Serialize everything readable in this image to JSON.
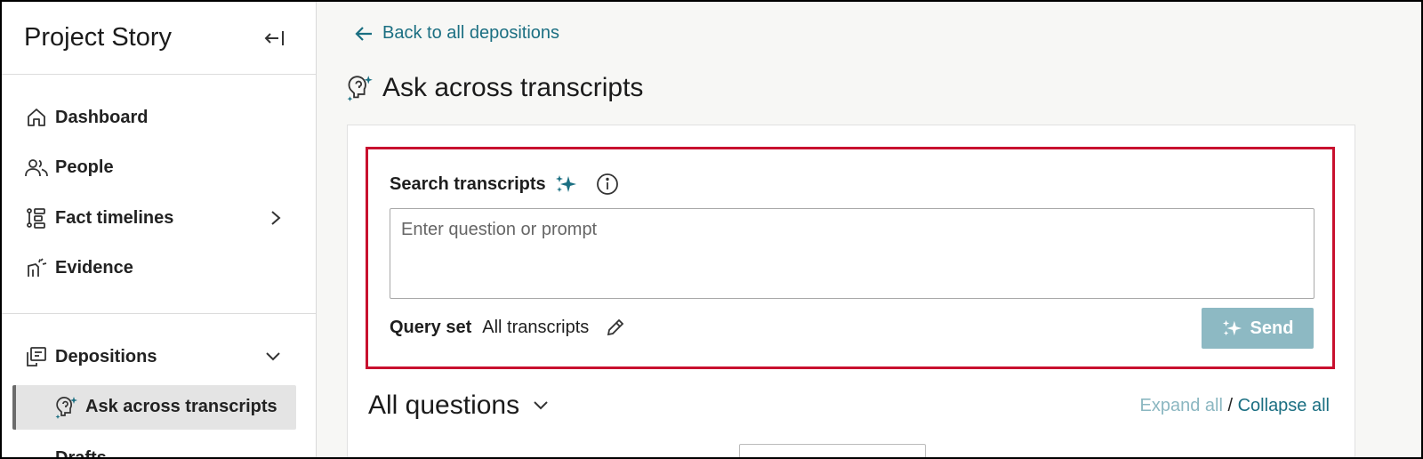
{
  "sidebar": {
    "title": "Project Story",
    "items": [
      {
        "label": "Dashboard",
        "icon": "home-icon"
      },
      {
        "label": "People",
        "icon": "people-icon"
      },
      {
        "label": "Fact timelines",
        "icon": "timeline-icon"
      },
      {
        "label": "Evidence",
        "icon": "evidence-icon"
      }
    ],
    "depositions_label": "Depositions",
    "sub_item_label": "Ask across transcripts",
    "cut_label": "Drafts"
  },
  "main": {
    "back_label": "Back to all depositions",
    "page_title": "Ask across transcripts",
    "search": {
      "label": "Search transcripts",
      "placeholder": "Enter question or prompt",
      "query_set_label": "Query set",
      "query_set_value": "All transcripts",
      "send_label": "Send"
    },
    "questions": {
      "title": "All questions",
      "expand_label": "Expand all",
      "separator": "/",
      "collapse_label": "Collapse all"
    }
  },
  "colors": {
    "accent": "#1b6f82",
    "highlight_border": "#c8102e",
    "send_disabled": "#8db9c3",
    "sparkle": "#1b6f82"
  }
}
